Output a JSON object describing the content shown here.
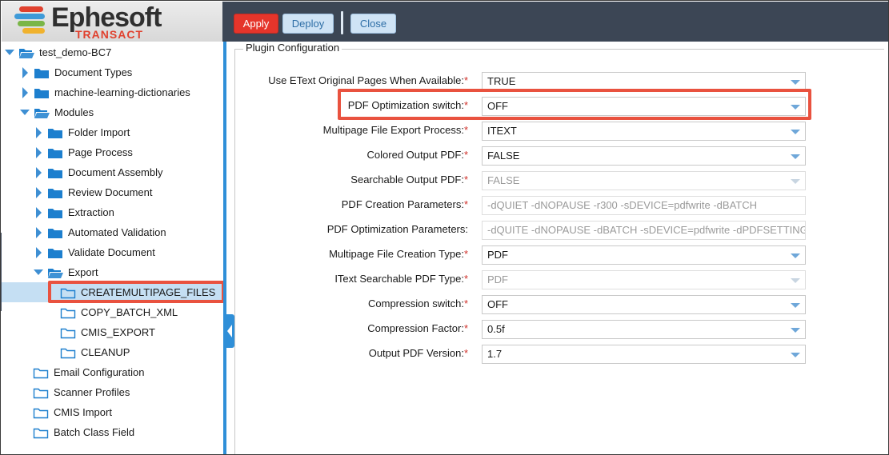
{
  "logo": {
    "brand": "Ephesoft",
    "sub": "TRANSACT",
    "bar_colors": [
      "#e0412e",
      "#3e9ad8",
      "#7ab648",
      "#f0b22e"
    ]
  },
  "toolbar": {
    "apply": "Apply",
    "deploy": "Deploy",
    "close": "Close"
  },
  "tree": {
    "root": "test_demo-BC7",
    "items": {
      "document_types": "Document Types",
      "ml_dictionaries": "machine-learning-dictionaries",
      "modules": "Modules",
      "folder_import": "Folder Import",
      "page_process": "Page Process",
      "document_assembly": "Document Assembly",
      "review_document": "Review Document",
      "extraction": "Extraction",
      "automated_validation": "Automated Validation",
      "validate_document": "Validate Document",
      "export": "Export",
      "createmultipage_files": "CREATEMULTIPAGE_FILES",
      "copy_batch_xml": "COPY_BATCH_XML",
      "cmis_export": "CMIS_EXPORT",
      "cleanup": "CLEANUP",
      "email_configuration": "Email Configuration",
      "scanner_profiles": "Scanner Profiles",
      "cmis_import": "CMIS Import",
      "batch_class_field": "Batch Class Field"
    }
  },
  "plugin": {
    "legend": "Plugin Configuration",
    "required_mark": "*",
    "rows": [
      {
        "label": "Use EText Original Pages When Available:",
        "required": true,
        "value": "TRUE",
        "type": "select",
        "disabled": false
      },
      {
        "label": "PDF Optimization switch:",
        "required": true,
        "value": "OFF",
        "type": "select",
        "disabled": false
      },
      {
        "label": "Multipage File Export Process:",
        "required": true,
        "value": "ITEXT",
        "type": "select",
        "disabled": false
      },
      {
        "label": "Colored Output PDF:",
        "required": true,
        "value": "FALSE",
        "type": "select",
        "disabled": false
      },
      {
        "label": "Searchable Output PDF:",
        "required": true,
        "value": "FALSE",
        "type": "select",
        "disabled": true
      },
      {
        "label": "PDF Creation Parameters:",
        "required": true,
        "value": "-dQUIET -dNOPAUSE -r300 -sDEVICE=pdfwrite -dBATCH",
        "type": "text",
        "disabled": true
      },
      {
        "label": "PDF Optimization Parameters:",
        "required": false,
        "value": "-dQUITE -dNOPAUSE -dBATCH -sDEVICE=pdfwrite -dPDFSETTINGS",
        "type": "text",
        "disabled": true
      },
      {
        "label": "Multipage File Creation Type:",
        "required": true,
        "value": "PDF",
        "type": "select",
        "disabled": false
      },
      {
        "label": "IText Searchable PDF Type:",
        "required": true,
        "value": "PDF",
        "type": "select",
        "disabled": true
      },
      {
        "label": "Compression switch:",
        "required": true,
        "value": "OFF",
        "type": "select",
        "disabled": false
      },
      {
        "label": "Compression Factor:",
        "required": true,
        "value": "0.5f",
        "type": "select",
        "disabled": false
      },
      {
        "label": "Output PDF Version:",
        "required": true,
        "value": "1.7",
        "type": "select",
        "disabled": false
      }
    ]
  },
  "colors": {
    "toolbar_bg": "#3c4655",
    "apply_bg": "#e5352b",
    "accent_blue": "#2f8fd8",
    "folder_blue": "#1d7fce",
    "highlight_red": "#e9523f",
    "selected_row": "#c5dff3"
  }
}
